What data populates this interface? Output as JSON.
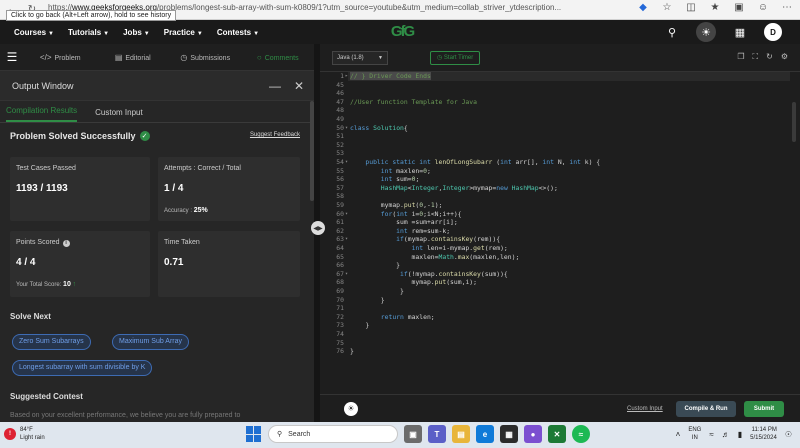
{
  "browser": {
    "tooltip": "Click to go back (Alt+Left arrow), hold to see history",
    "url_scheme": "https://",
    "url_host": "www.geeksforgeeks.org",
    "url_path": "/problems/longest-sub-array-with-sum-k0809/1?utm_source=youtube&utm_medium=collab_striver_ytdescription..."
  },
  "header": {
    "logo": "GfG",
    "menu": [
      "Courses",
      "Tutorials",
      "Jobs",
      "Practice",
      "Contests"
    ],
    "avatar_letter": "D"
  },
  "problem_tabs": [
    "Problem",
    "Editorial",
    "Submissions",
    "Comments"
  ],
  "output": {
    "title": "Output Window",
    "tabs": [
      "Compilation Results",
      "Custom Input"
    ],
    "status": "Problem Solved Successfully",
    "suggest_feedback": "Suggest Feedback",
    "test_cases_label": "Test Cases Passed",
    "test_cases_value": "1193 / 1193",
    "attempts_label": "Attempts : Correct / Total",
    "attempts_value": "1 / 4",
    "accuracy_label": "Accuracy :",
    "accuracy_value": "25%",
    "points_label": "Points Scored",
    "points_value": "4 / 4",
    "total_score_label": "Your Total Score:",
    "total_score_value": "10",
    "time_label": "Time Taken",
    "time_value": "0.71",
    "solve_next_title": "Solve Next",
    "solve_next": [
      "Zero Sum Subarrays",
      "Maximum Sub Array",
      "Longest subarray with sum divisible by K"
    ],
    "suggested_contest_title": "Suggested Contest",
    "faded_text": "Based on your excellent performance, we believe you are fully prepared to"
  },
  "editor": {
    "language": "Java (1.8)",
    "timer_label": "Start Timer",
    "custom_input_link": "Custom Input",
    "compile_run": "Compile & Run",
    "submit": "Submit"
  },
  "taskbar": {
    "weather_temp": "84°F",
    "weather_desc": "Light rain",
    "search_placeholder": "Search",
    "lang_top": "ENG",
    "lang_bottom": "IN",
    "time": "11:14 PM",
    "date": "5/15/2024"
  }
}
